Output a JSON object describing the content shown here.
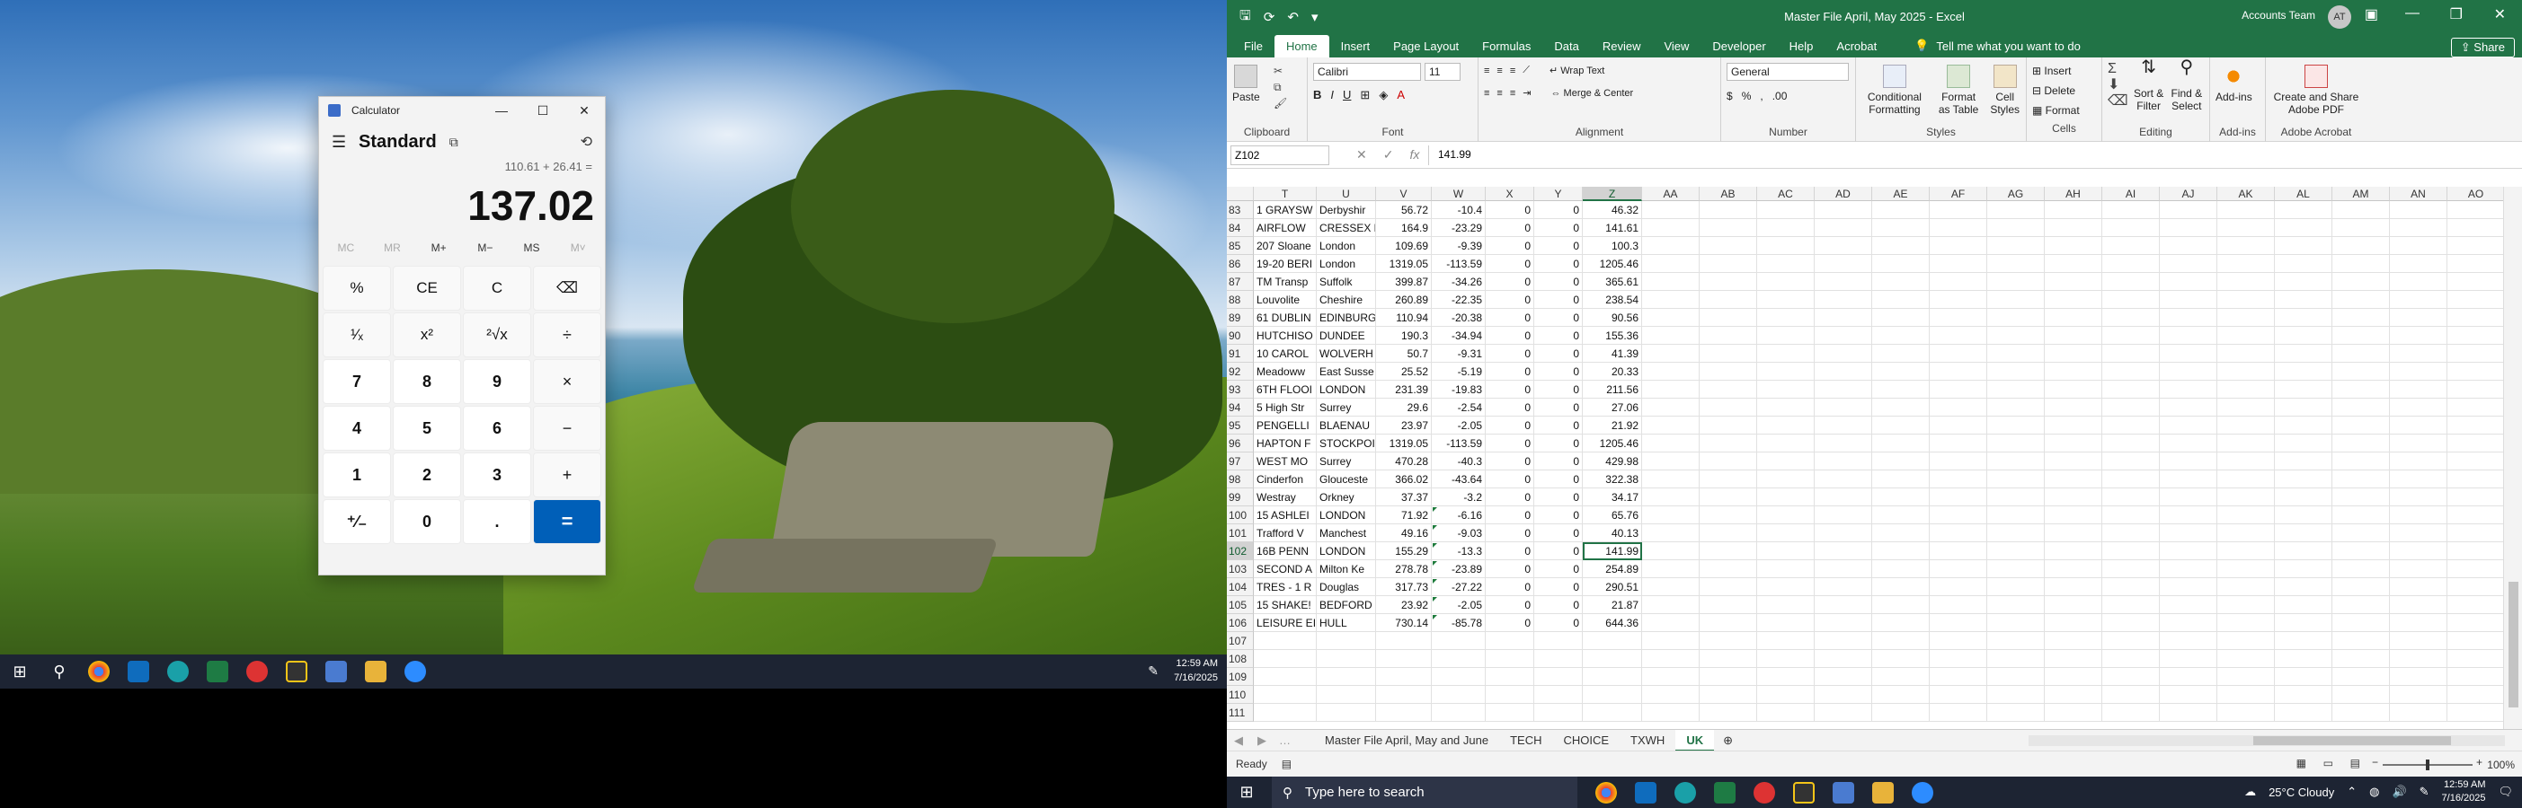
{
  "left_screen": {
    "taskbar": {
      "time": "12:59 AM",
      "date": "7/16/2025"
    },
    "calculator": {
      "window_title": "Calculator",
      "mode": "Standard",
      "expression": "110.61 + 26.41 =",
      "display": "137.02",
      "memory": [
        "MC",
        "MR",
        "M+",
        "M−",
        "MS",
        "M˅"
      ],
      "keys": [
        "%",
        "CE",
        "C",
        "⌫",
        "¹⁄ₓ",
        "x²",
        "²√x",
        "÷",
        "7",
        "8",
        "9",
        "×",
        "4",
        "5",
        "6",
        "−",
        "1",
        "2",
        "3",
        "+",
        "⁺⁄₋",
        "0",
        ".",
        "="
      ]
    }
  },
  "excel": {
    "title": "Master File April, May 2025  -  Excel",
    "account": "Accounts Team",
    "avatar": "AT",
    "share": "Share",
    "tabs": [
      "File",
      "Home",
      "Insert",
      "Page Layout",
      "Formulas",
      "Data",
      "Review",
      "View",
      "Developer",
      "Help",
      "Acrobat"
    ],
    "tell_me": "Tell me what you want to do",
    "ribbon": {
      "paste": "Paste",
      "clipboard": "Clipboard",
      "font_name": "Calibri",
      "font_size": "11",
      "font": "Font",
      "wrap_text": "Wrap Text",
      "merge_center": "Merge & Center",
      "alignment": "Alignment",
      "number_format": "General",
      "number": "Number",
      "conditional": "Conditional Formatting",
      "format_table": "Format as Table",
      "cell_styles": "Cell Styles",
      "styles": "Styles",
      "insert": "Insert",
      "delete": "Delete",
      "format": "Format",
      "cells": "Cells",
      "sort": "Sort & Filter",
      "find": "Find & Select",
      "editing": "Editing",
      "addins": "Add-ins",
      "addins_group": "Add-ins",
      "create_pdf": "Create and Share Adobe PDF",
      "adobe": "Adobe Acrobat"
    },
    "name_box": "Z102",
    "formula": "141.99",
    "columns": [
      "T",
      "U",
      "V",
      "W",
      "X",
      "Y",
      "Z",
      "AA",
      "AB",
      "AC",
      "AD",
      "AE",
      "AF",
      "AG",
      "AH",
      "AI",
      "AJ",
      "AK",
      "AL",
      "AM",
      "AN",
      "AO"
    ],
    "rows": [
      {
        "n": "83",
        "T": "1 GRAYSW",
        "U": "Derbyshir",
        "V": "56.72",
        "W": "-10.4",
        "X": "0",
        "Y": "0",
        "Z": "46.32"
      },
      {
        "n": "84",
        "T": "AIRFLOW",
        "U": "CRESSEX E",
        "V": "164.9",
        "W": "-23.29",
        "X": "0",
        "Y": "0",
        "Z": "141.61"
      },
      {
        "n": "85",
        "T": "207 Sloane",
        "U": "London",
        "V": "109.69",
        "W": "-9.39",
        "X": "0",
        "Y": "0",
        "Z": "100.3"
      },
      {
        "n": "86",
        "T": "19-20 BERI",
        "U": "London",
        "V": "1319.05",
        "W": "-113.59",
        "X": "0",
        "Y": "0",
        "Z": "1205.46"
      },
      {
        "n": "87",
        "T": "TM Transp",
        "U": "Suffolk",
        "V": "399.87",
        "W": "-34.26",
        "X": "0",
        "Y": "0",
        "Z": "365.61"
      },
      {
        "n": "88",
        "T": "Louvolite",
        "U": "Cheshire",
        "V": "260.89",
        "W": "-22.35",
        "X": "0",
        "Y": "0",
        "Z": "238.54"
      },
      {
        "n": "89",
        "T": "61 DUBLIN",
        "U": "EDINBURG",
        "V": "110.94",
        "W": "-20.38",
        "X": "0",
        "Y": "0",
        "Z": "90.56"
      },
      {
        "n": "90",
        "T": "HUTCHISO",
        "U": "DUNDEE",
        "V": "190.3",
        "W": "-34.94",
        "X": "0",
        "Y": "0",
        "Z": "155.36"
      },
      {
        "n": "91",
        "T": "10 CAROL",
        "U": "WOLVERH",
        "V": "50.7",
        "W": "-9.31",
        "X": "0",
        "Y": "0",
        "Z": "41.39"
      },
      {
        "n": "92",
        "T": "Meadoww",
        "U": "East Susse",
        "V": "25.52",
        "W": "-5.19",
        "X": "0",
        "Y": "0",
        "Z": "20.33"
      },
      {
        "n": "93",
        "T": "6TH FLOOI",
        "U": "LONDON",
        "V": "231.39",
        "W": "-19.83",
        "X": "0",
        "Y": "0",
        "Z": "211.56"
      },
      {
        "n": "94",
        "T": "5 High Str",
        "U": "Surrey",
        "V": "29.6",
        "W": "-2.54",
        "X": "0",
        "Y": "0",
        "Z": "27.06"
      },
      {
        "n": "95",
        "T": "PENGELLI",
        "U": "BLAENAU",
        "V": "23.97",
        "W": "-2.05",
        "X": "0",
        "Y": "0",
        "Z": "21.92"
      },
      {
        "n": "96",
        "T": "HAPTON F",
        "U": "STOCKPOI",
        "V": "1319.05",
        "W": "-113.59",
        "X": "0",
        "Y": "0",
        "Z": "1205.46"
      },
      {
        "n": "97",
        "T": "WEST MO",
        "U": "Surrey",
        "V": "470.28",
        "W": "-40.3",
        "X": "0",
        "Y": "0",
        "Z": "429.98"
      },
      {
        "n": "98",
        "T": "Cinderfon",
        "U": "Glouceste",
        "V": "366.02",
        "W": "-43.64",
        "X": "0",
        "Y": "0",
        "Z": "322.38"
      },
      {
        "n": "99",
        "T": "Westray",
        "U": "Orkney",
        "V": "37.37",
        "W": "-3.2",
        "X": "0",
        "Y": "0",
        "Z": "34.17"
      },
      {
        "n": "100",
        "T": "15 ASHLEI",
        "U": "LONDON",
        "V": "71.92",
        "W": "-6.16",
        "X": "0",
        "Y": "0",
        "Z": "65.76"
      },
      {
        "n": "101",
        "T": "Trafford V",
        "U": "Manchest",
        "V": "49.16",
        "W": "-9.03",
        "X": "0",
        "Y": "0",
        "Z": "40.13"
      },
      {
        "n": "102",
        "T": "16B PENN",
        "U": "LONDON",
        "V": "155.29",
        "W": "-13.3",
        "X": "0",
        "Y": "0",
        "Z": "141.99"
      },
      {
        "n": "103",
        "T": "SECOND A",
        "U": "Milton Ke",
        "V": "278.78",
        "W": "-23.89",
        "X": "0",
        "Y": "0",
        "Z": "254.89"
      },
      {
        "n": "104",
        "T": "TRES - 1 R",
        "U": "Douglas",
        "V": "317.73",
        "W": "-27.22",
        "X": "0",
        "Y": "0",
        "Z": "290.51"
      },
      {
        "n": "105",
        "T": "15 SHAKE!",
        "U": "BEDFORD",
        "V": "23.92",
        "W": "-2.05",
        "X": "0",
        "Y": "0",
        "Z": "21.87"
      },
      {
        "n": "106",
        "T": "LEISURE EI",
        "U": "HULL",
        "V": "730.14",
        "W": "-85.78",
        "X": "0",
        "Y": "0",
        "Z": "644.36"
      },
      {
        "n": "107"
      },
      {
        "n": "108"
      },
      {
        "n": "109"
      },
      {
        "n": "110"
      },
      {
        "n": "111"
      }
    ],
    "sheets": [
      "Master File April, May and June",
      "TECH",
      "CHOICE",
      "TXWH",
      "UK"
    ],
    "active_sheet": "UK",
    "status": "Ready",
    "zoom": "100%"
  },
  "right_taskbar": {
    "search_placeholder": "Type here to search",
    "weather": "25°C  Cloudy",
    "time": "12:59 AM",
    "date": "7/16/2025"
  }
}
